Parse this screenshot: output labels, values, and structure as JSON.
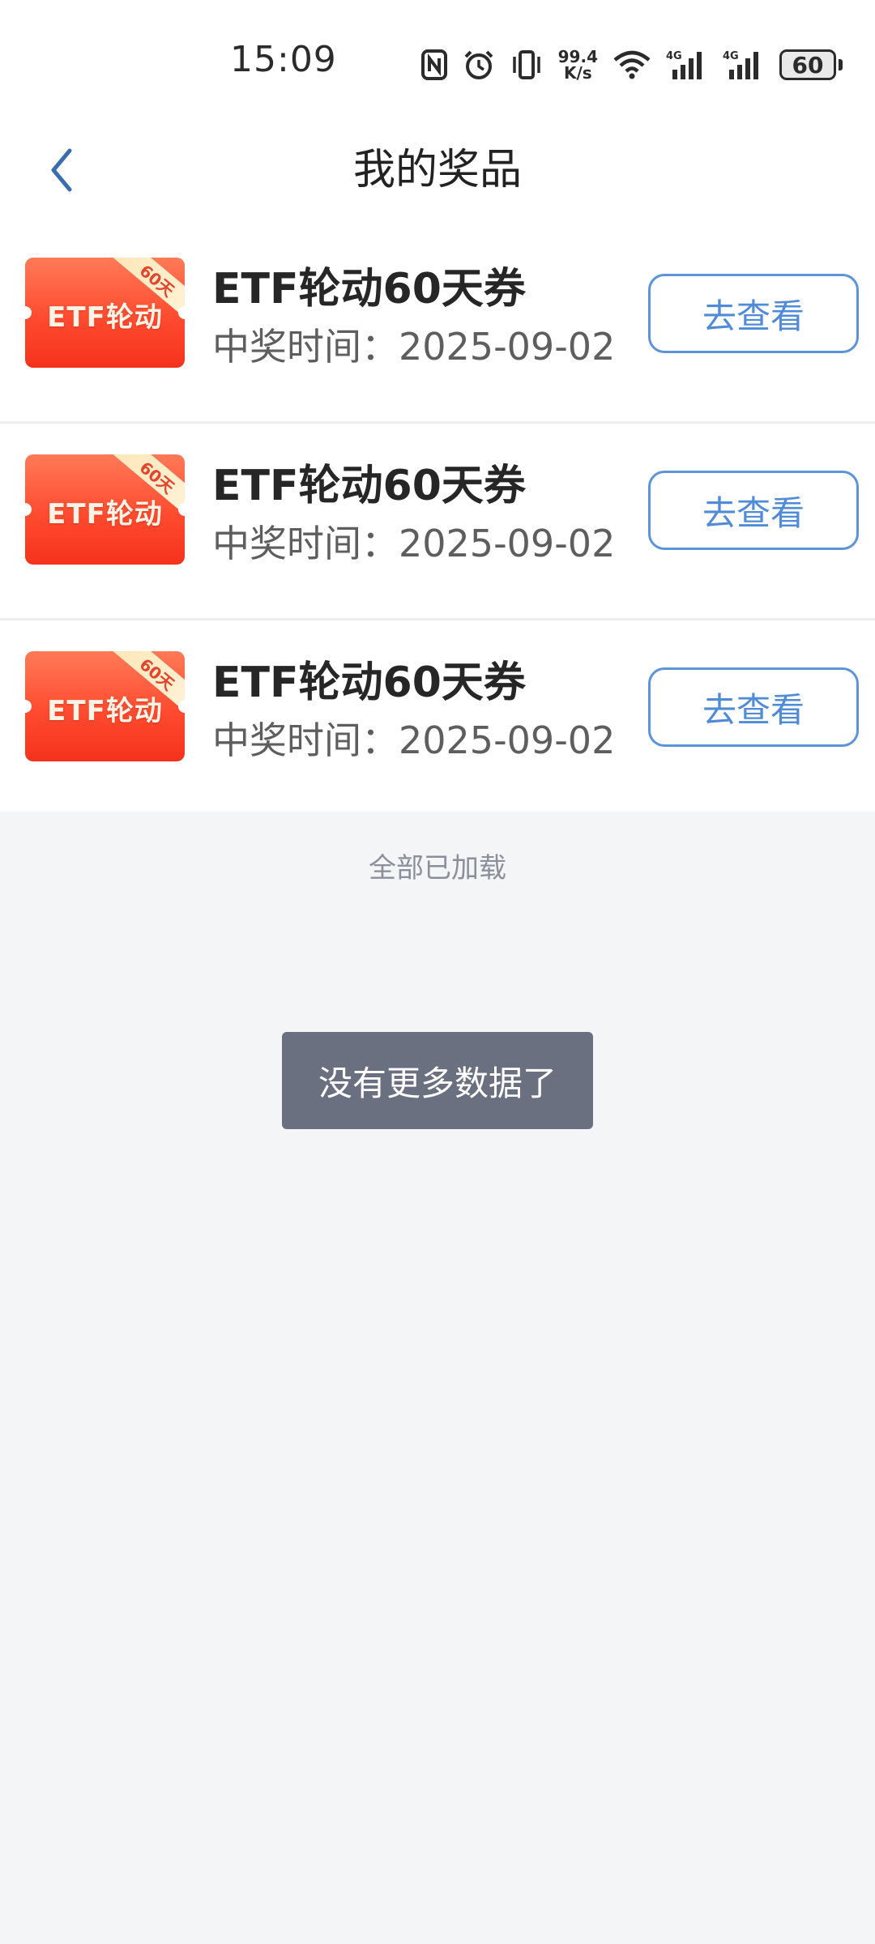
{
  "status_bar": {
    "time": "15:09",
    "speed_value": "99.4",
    "speed_unit": "K/s",
    "network_1": "4G",
    "network_2": "4G",
    "battery": "60",
    "icons": [
      "nfc-icon",
      "alarm-icon",
      "vibrate-icon",
      "wifi-icon",
      "signal-icon",
      "battery-icon"
    ]
  },
  "header": {
    "title": "我的奖品",
    "back_icon": "chevron-left-icon"
  },
  "prizes": [
    {
      "badge": "60天",
      "coupon_label": "ETF轮动",
      "name": "ETF轮动60天券",
      "time": "中奖时间：2025-09-02",
      "button": "去查看"
    },
    {
      "badge": "60天",
      "coupon_label": "ETF轮动",
      "name": "ETF轮动60天券",
      "time": "中奖时间：2025-09-02",
      "button": "去查看"
    },
    {
      "badge": "60天",
      "coupon_label": "ETF轮动",
      "name": "ETF轮动60天券",
      "time": "中奖时间：2025-09-02",
      "button": "去查看"
    }
  ],
  "footer": {
    "loaded_text": "全部已加载",
    "toast": "没有更多数据了"
  },
  "colors": {
    "accent": "#4f8bd6",
    "coupon": "#ff4b2f",
    "toast_bg": "#6b7080",
    "page_bg": "#f4f5f7"
  }
}
